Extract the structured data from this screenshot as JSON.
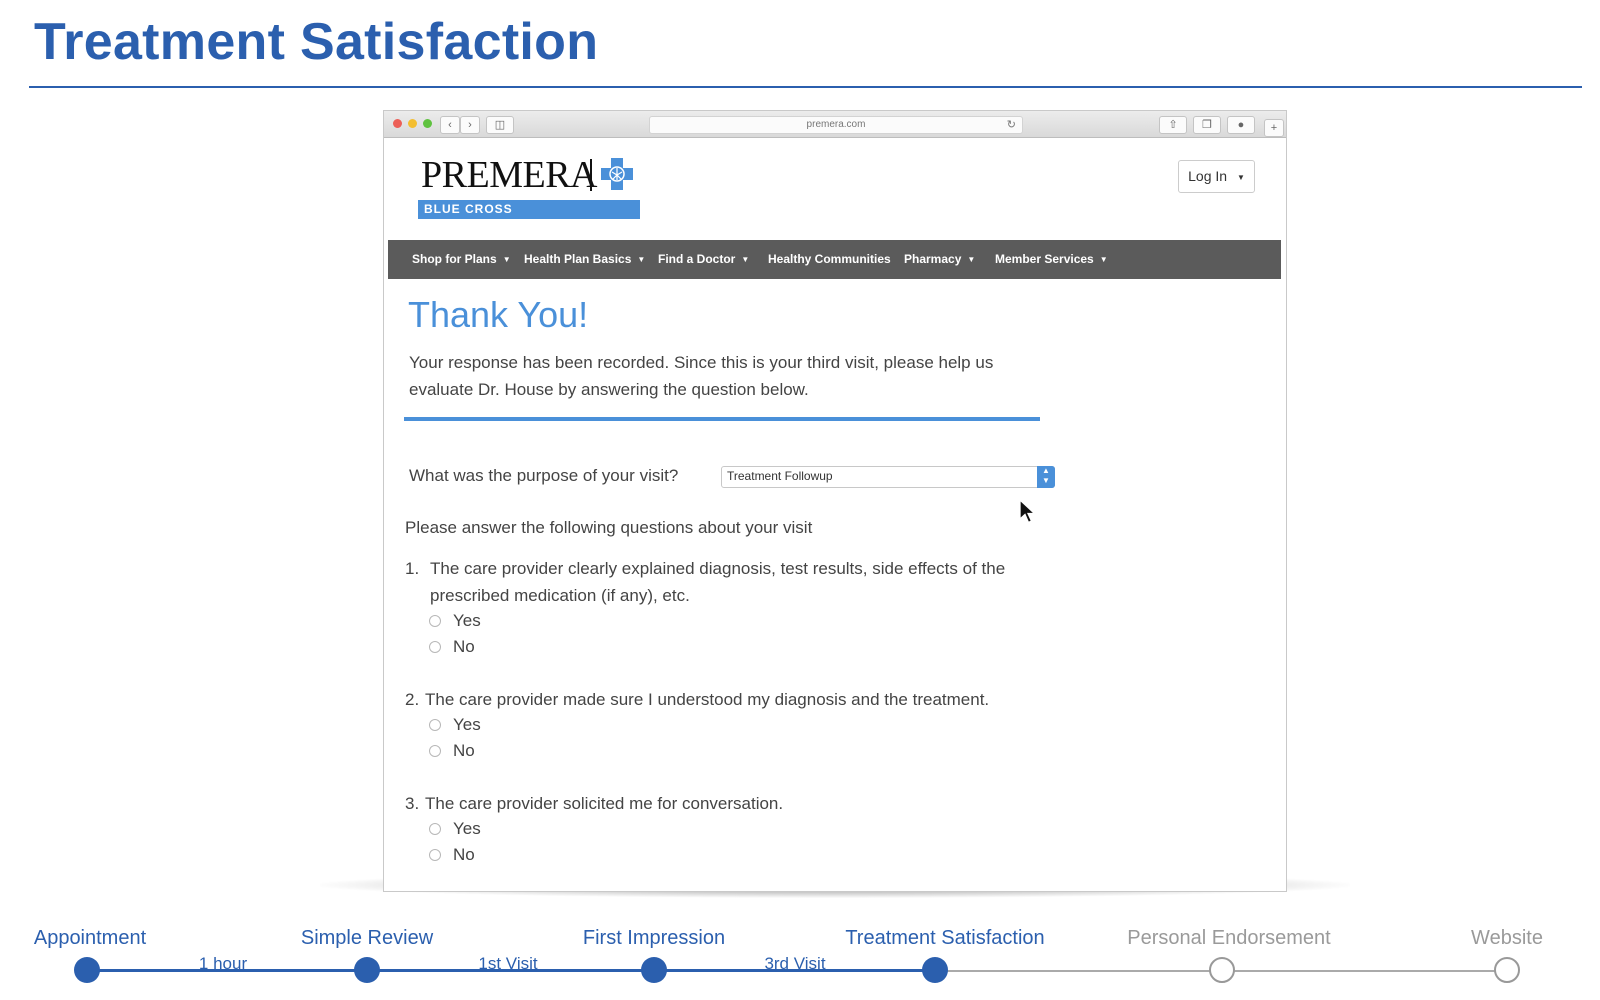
{
  "slide": {
    "title": "Treatment Satisfaction"
  },
  "browser": {
    "url": "premera.com",
    "traffic_lights": [
      "#ec5f57",
      "#f3be30",
      "#5fc23f"
    ],
    "icons": [
      "back-icon",
      "forward-icon",
      "sidebar-icon",
      "reload-icon",
      "share-icon",
      "tabs-icon",
      "download-icon",
      "new-tab-icon"
    ]
  },
  "site": {
    "logo": {
      "wordmark": "PREMERA",
      "band_text": "BLUE CROSS",
      "band_color": "#4a90d9"
    },
    "login_label": "Log In",
    "nav": [
      {
        "label": "Shop for Plans",
        "has_caret": true
      },
      {
        "label": "Health Plan Basics",
        "has_caret": true
      },
      {
        "label": "Find a Doctor",
        "has_caret": true
      },
      {
        "label": "Healthy Communities",
        "has_caret": false
      },
      {
        "label": "Pharmacy",
        "has_caret": true
      },
      {
        "label": "Member Services",
        "has_caret": true
      }
    ]
  },
  "form": {
    "heading": "Thank You!",
    "response": "Your response has been recorded. Since this is your third visit, please help us evaluate Dr. House by answering the question below.",
    "purpose_label": "What was the purpose of your visit?",
    "purpose_value": "Treatment Followup",
    "intro": "Please answer the following questions about your visit",
    "questions": [
      {
        "number": "1.",
        "text": "The care provider clearly explained diagnosis, test results, side effects of the prescribed medication (if any), etc.",
        "options": [
          "Yes",
          "No"
        ]
      },
      {
        "number": "2.",
        "text": "The care provider made sure I understood my diagnosis and the treatment.",
        "options": [
          "Yes",
          "No"
        ]
      },
      {
        "number": "3.",
        "text": "The care provider solicited me for conversation.",
        "options": [
          "Yes",
          "No"
        ]
      }
    ]
  },
  "timeline": {
    "active_color": "#2b5fae",
    "inactive_color": "#aaaaaa",
    "steps": [
      {
        "label": "Appointment",
        "active": true
      },
      {
        "label": "Simple Review",
        "active": true
      },
      {
        "label": "First Impression",
        "active": true
      },
      {
        "label": "Treatment Satisfaction",
        "active": true
      },
      {
        "label": "Personal Endorsement",
        "active": false
      },
      {
        "label": "Website",
        "active": false
      }
    ],
    "gaps": [
      "1 hour",
      "1st Visit",
      "3rd Visit"
    ]
  }
}
